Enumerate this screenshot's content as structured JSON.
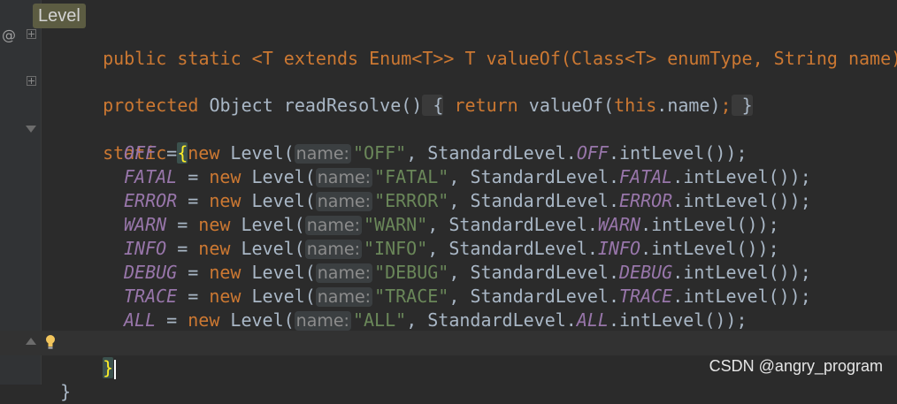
{
  "tooltip": {
    "label": "Level"
  },
  "code": {
    "line0": {
      "text": "public static <T extends Enum<T>> T valueOf(Class<T> enumType, String name) {"
    },
    "line1": {
      "kw": "protected",
      "t1": " Object readResolve()",
      "brace1": " {",
      "kw2": " return",
      "t2": " valueOf(",
      "kw3": "this",
      "t3": ".name)",
      "semi": ";",
      "brace2": " }"
    },
    "static_block": {
      "kw": "static",
      "open": "{"
    },
    "levels": [
      {
        "var": "OFF",
        "hint": "name:",
        "str": "\"OFF\"",
        "field": "OFF"
      },
      {
        "var": "FATAL",
        "hint": "name:",
        "str": "\"FATAL\"",
        "field": "FATAL"
      },
      {
        "var": "ERROR",
        "hint": "name:",
        "str": "\"ERROR\"",
        "field": "ERROR"
      },
      {
        "var": "WARN",
        "hint": "name:",
        "str": "\"WARN\"",
        "field": "WARN"
      },
      {
        "var": "INFO",
        "hint": "name:",
        "str": "\"INFO\"",
        "field": "INFO"
      },
      {
        "var": "DEBUG",
        "hint": "name:",
        "str": "\"DEBUG\"",
        "field": "DEBUG"
      },
      {
        "var": "TRACE",
        "hint": "name:",
        "str": "\"TRACE\"",
        "field": "TRACE"
      },
      {
        "var": "ALL",
        "hint": "name:",
        "str": "\"ALL\"",
        "field": "ALL"
      }
    ],
    "tokens": {
      "eq": " = ",
      "new": "new",
      "ctor": " Level(",
      "comma": ", StandardLevel.",
      "tail": ".intLevel());"
    },
    "close_static": "}",
    "close_class": "}"
  },
  "watermark": "CSDN @angry_program",
  "gutter": {
    "at_icon": "@",
    "bulb_icon": "lightbulb-icon"
  }
}
